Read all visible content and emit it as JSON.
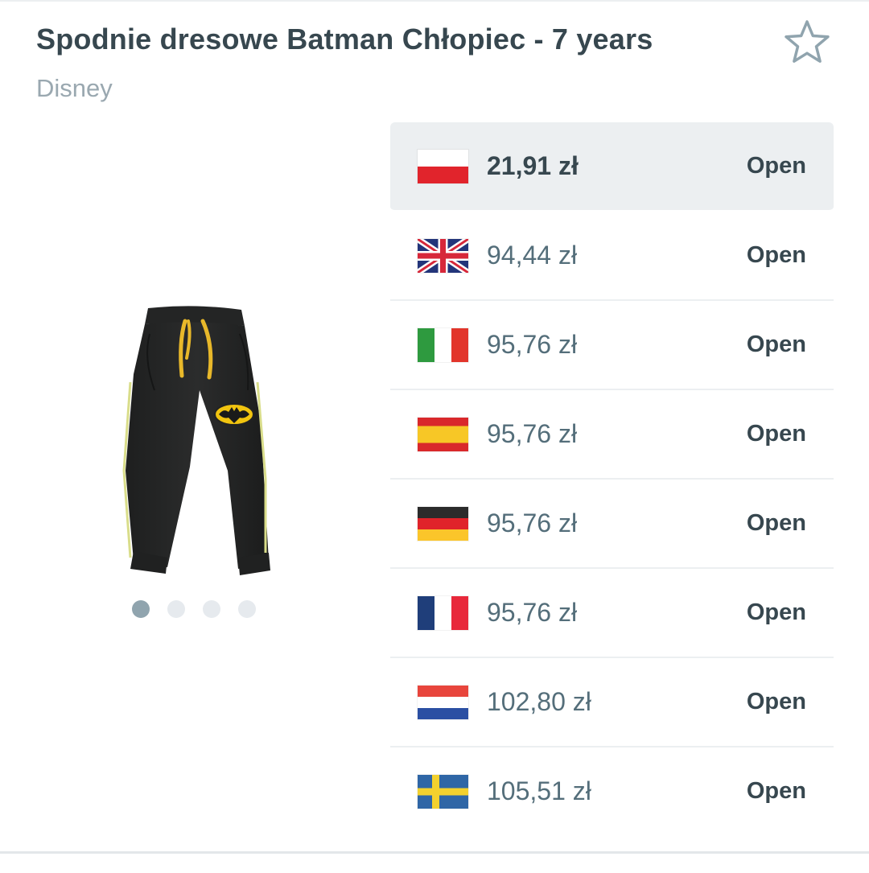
{
  "product": {
    "title": "Spodnie dresowe Batman Chłopiec - 7 years",
    "brand": "Disney",
    "favorite_icon": "star-outline-icon",
    "image_count": 4,
    "image_active_index": 0
  },
  "offers": [
    {
      "country": "PL",
      "flag_icon": "flag-poland-icon",
      "price": "21,91 zł",
      "action": "Open",
      "selected": true
    },
    {
      "country": "UK",
      "flag_icon": "flag-uk-icon",
      "price": "94,44 zł",
      "action": "Open",
      "selected": false
    },
    {
      "country": "IT",
      "flag_icon": "flag-italy-icon",
      "price": "95,76 zł",
      "action": "Open",
      "selected": false
    },
    {
      "country": "ES",
      "flag_icon": "flag-spain-icon",
      "price": "95,76 zł",
      "action": "Open",
      "selected": false
    },
    {
      "country": "DE",
      "flag_icon": "flag-germany-icon",
      "price": "95,76 zł",
      "action": "Open",
      "selected": false
    },
    {
      "country": "FR",
      "flag_icon": "flag-france-icon",
      "price": "95,76 zł",
      "action": "Open",
      "selected": false
    },
    {
      "country": "NL",
      "flag_icon": "flag-netherlands-icon",
      "price": "102,80 zł",
      "action": "Open",
      "selected": false
    },
    {
      "country": "SE",
      "flag_icon": "flag-sweden-icon",
      "price": "105,51 zł",
      "action": "Open",
      "selected": false
    }
  ],
  "colors": {
    "text_primary": "#37474f",
    "text_secondary": "#9aa8b0",
    "selected_row_bg": "#eceff1",
    "dot_active": "#90a4ae",
    "dot_inactive": "#e6eaee"
  }
}
